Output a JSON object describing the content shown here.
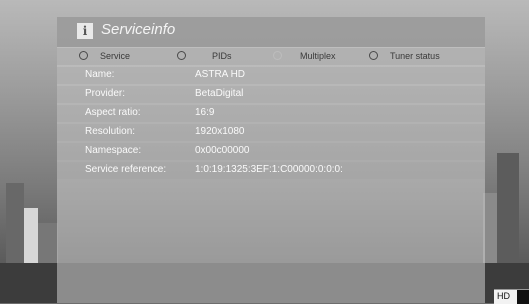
{
  "window": {
    "title": "Serviceinfo"
  },
  "tabs": [
    {
      "label": "Service",
      "active": true
    },
    {
      "label": "PIDs",
      "active": false
    },
    {
      "label": "Multiplex",
      "active": false
    },
    {
      "label": "Tuner status",
      "active": true
    }
  ],
  "info": [
    {
      "key": "Name:",
      "value": "ASTRA HD"
    },
    {
      "key": "Provider:",
      "value": "BetaDigital"
    },
    {
      "key": "Aspect ratio:",
      "value": "16:9"
    },
    {
      "key": "Resolution:",
      "value": "1920x1080"
    },
    {
      "key": "Namespace:",
      "value": "0x00c00000"
    },
    {
      "key": "Service reference:",
      "value": "1:0:19:1325:3EF:1:C00000:0:0:0:"
    }
  ],
  "badge": {
    "label": "HD"
  },
  "icons": {
    "header": "info-icon",
    "tab": "radio-icon"
  }
}
